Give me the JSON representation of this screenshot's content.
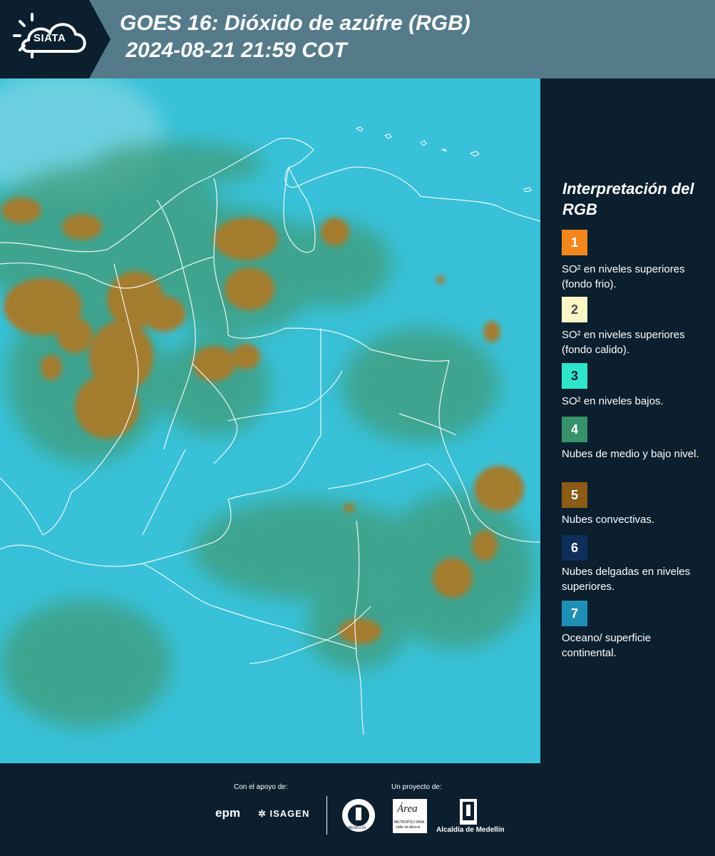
{
  "header": {
    "logo_text": "SIATA",
    "title": "GOES 16: Dióxido de azúfre (RGB)\n 2024-08-21 21:59 COT"
  },
  "legend": {
    "title": "Interpretación del RGB",
    "items": [
      {
        "number": "1",
        "color": "#f3861c",
        "number_color": "#ffffff",
        "text": "SO² en niveles superiores (fondo frio)."
      },
      {
        "number": "2",
        "color": "#fbf5c6",
        "number_color": "#4a4a4a",
        "text": "SO² en niveles superiores (fondo calido)."
      },
      {
        "number": "3",
        "color": "#2fe6cc",
        "number_color": "#0b1f2e",
        "text": "SO² en niveles bajos."
      },
      {
        "number": "4",
        "color": "#35926a",
        "number_color": "#ffffff",
        "text": "Nubes de medio y bajo nivel."
      },
      {
        "number": "5",
        "color": "#8c5b18",
        "number_color": "#ffffff",
        "text": "Nubes convectivas."
      },
      {
        "number": "6",
        "color": "#0f2e5c",
        "number_color": "#ffffff",
        "text": "Nubes delgadas en niveles superiores."
      },
      {
        "number": "7",
        "color": "#1f8fb6",
        "number_color": "#ffffff",
        "text": "Oceano/ superficie continental."
      }
    ]
  },
  "footer": {
    "support_label": "Con el apoyo de:",
    "project_label": "Un proyecto de:",
    "epm": "epm",
    "isagen": "ISAGEN",
    "area_text": "Área",
    "metro_text": "METROPOLITANA",
    "valle_text": "Valle de Aburrá",
    "alcaldia": "Alcaldía de Medellín",
    "medellin_seal": "MEDELLÍN"
  },
  "colors": {
    "ocean": "#35c0d6",
    "green": "#3c9a7a",
    "convective": "#a27a2a",
    "header": "#557b8a",
    "background": "#0b1f2e"
  }
}
